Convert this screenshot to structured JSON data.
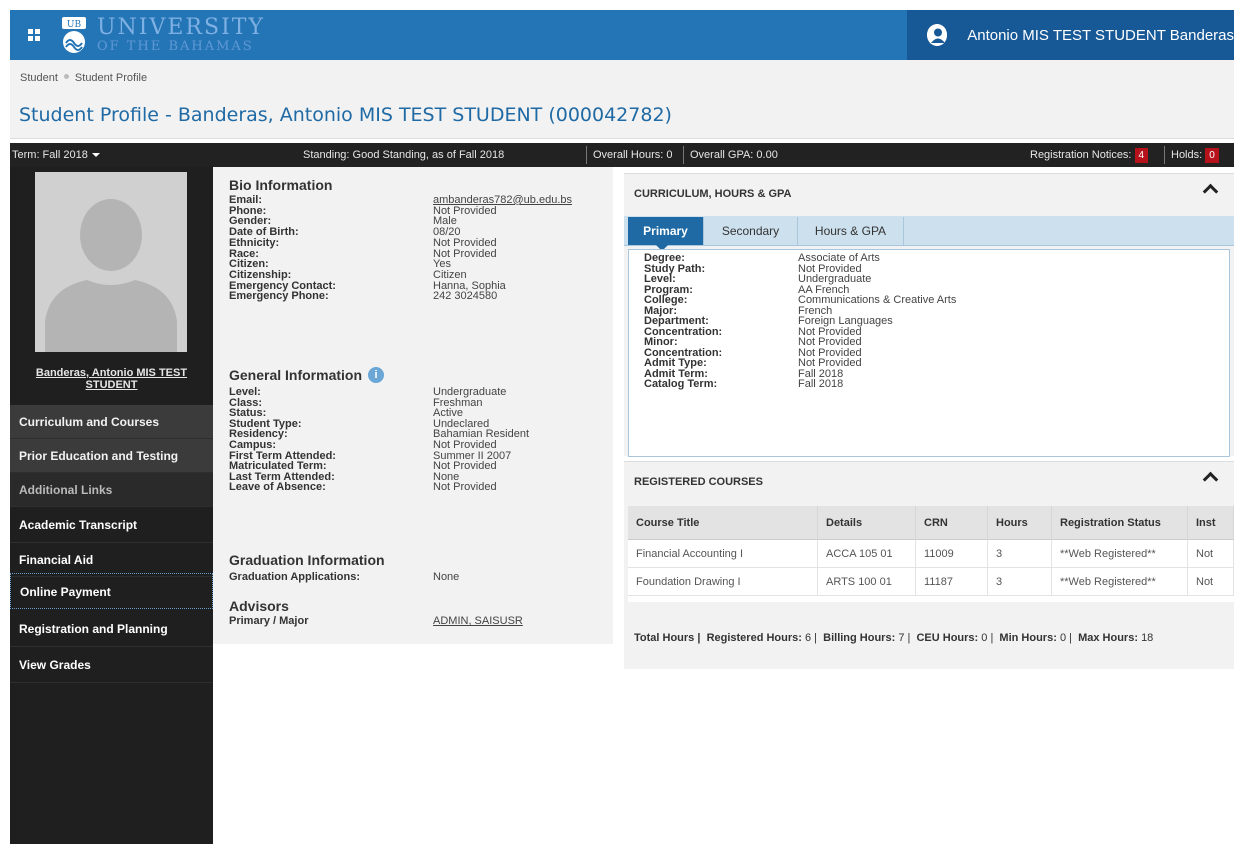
{
  "header": {
    "logo_line1": "UNIVERSITY",
    "logo_line2": "OF THE BAHAMAS",
    "logo_badge": "UB",
    "user_name": "Antonio MIS TEST STUDENT Banderas"
  },
  "breadcrumb": [
    "Student",
    "Student Profile"
  ],
  "page_title": "Student Profile - Banderas, Antonio MIS TEST STUDENT (000042782)",
  "statbar": {
    "term": "Term: Fall 2018",
    "standing": "Standing: Good Standing, as of Fall 2018",
    "overall_hours": "Overall Hours: 0",
    "overall_gpa": "Overall GPA: 0.00",
    "registration_notices_label": "Registration Notices:",
    "registration_notices_count": "4",
    "holds_label": "Holds:",
    "holds_count": "0"
  },
  "sidebar": {
    "student_link": "Banderas, Antonio MIS TEST STUDENT",
    "items": [
      "Curriculum and Courses",
      "Prior Education and Testing",
      "Additional Links",
      "Academic Transcript",
      "Financial Aid",
      "Online Payment",
      "Registration and Planning",
      "View Grades"
    ]
  },
  "bio": {
    "title": "Bio Information",
    "rows": [
      [
        "Email:",
        "ambanderas782@ub.edu.bs"
      ],
      [
        "Phone:",
        "Not Provided"
      ],
      [
        "Gender:",
        "Male"
      ],
      [
        "Date of Birth:",
        "08/20"
      ],
      [
        "Ethnicity:",
        "Not Provided"
      ],
      [
        "Race:",
        "Not Provided"
      ],
      [
        "Citizen:",
        "Yes"
      ],
      [
        "Citizenship:",
        "Citizen"
      ],
      [
        "Emergency Contact:",
        "Hanna, Sophia"
      ],
      [
        "Emergency Phone:",
        "242 3024580"
      ]
    ]
  },
  "general": {
    "title": "General Information",
    "rows": [
      [
        "Level:",
        "Undergraduate"
      ],
      [
        "Class:",
        "Freshman"
      ],
      [
        "Status:",
        "Active"
      ],
      [
        "Student Type:",
        "Undeclared"
      ],
      [
        "Residency:",
        "Bahamian Resident"
      ],
      [
        "Campus:",
        "Not Provided"
      ],
      [
        "First Term Attended:",
        "Summer II 2007"
      ],
      [
        "Matriculated Term:",
        "Not Provided"
      ],
      [
        "Last Term Attended:",
        "None"
      ],
      [
        "Leave of Absence:",
        "Not Provided"
      ]
    ]
  },
  "graduation": {
    "title": "Graduation Information",
    "rows": [
      [
        "Graduation Applications:",
        "None"
      ]
    ]
  },
  "advisors": {
    "title": "Advisors",
    "rows": [
      [
        "Primary / Major",
        "ADMIN, SAISUSR"
      ]
    ]
  },
  "curriculum": {
    "title": "CURRICULUM, HOURS & GPA",
    "tabs": [
      "Primary",
      "Secondary",
      "Hours & GPA"
    ],
    "rows": [
      [
        "Degree:",
        "Associate of Arts"
      ],
      [
        "Study Path:",
        "Not Provided"
      ],
      [
        "Level:",
        "Undergraduate"
      ],
      [
        "Program:",
        "AA French"
      ],
      [
        "College:",
        "Communications & Creative Arts"
      ],
      [
        "Major:",
        "French"
      ],
      [
        "Department:",
        "Foreign Languages"
      ],
      [
        "Concentration:",
        "Not Provided"
      ],
      [
        "Minor:",
        "Not Provided"
      ],
      [
        "Concentration:",
        "Not Provided"
      ],
      [
        "Admit Type:",
        "Not Provided"
      ],
      [
        "Admit Term:",
        "Fall 2018"
      ],
      [
        "Catalog Term:",
        "Fall 2018"
      ]
    ]
  },
  "courses": {
    "title": "REGISTERED COURSES",
    "columns": [
      "Course Title",
      "Details",
      "CRN",
      "Hours",
      "Registration Status",
      "Inst"
    ],
    "rows": [
      [
        "Financial Accounting I",
        "ACCA 105 01",
        "11009",
        "3",
        "**Web Registered**",
        "Not"
      ],
      [
        "Foundation Drawing I",
        "ARTS 100 01",
        "11187",
        "3",
        "**Web Registered**",
        "Not"
      ]
    ],
    "totals": {
      "total_label": "Total Hours |",
      "registered_label": "Registered Hours:",
      "registered": "6",
      "billing_label": "Billing Hours:",
      "billing": "7",
      "ceu_label": "CEU Hours:",
      "ceu": "0",
      "min_label": "Min Hours:",
      "min": "0",
      "max_label": "Max Hours:",
      "max": "18"
    }
  },
  "colors": {
    "header_blue": "#2475b6",
    "user_area": "#175896",
    "title_blue": "#1f6aa5",
    "badge_red": "#b5121b",
    "sidebar_dark": "#1f1f1f"
  }
}
